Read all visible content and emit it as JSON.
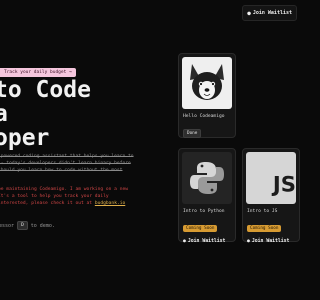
{
  "header": {
    "waitlist_label": "Join Waitlist",
    "waitlist_icon": "bell-icon"
  },
  "banner": {
    "text": "Track your daily budget →"
  },
  "hero": {
    "line1": "to Code",
    "line2": "a",
    "line3": "oper"
  },
  "description": {
    "text": "-powered coding assistant that helps you learn to -- today's developers didn't learn binary before should you learn how to code without the most"
  },
  "notice": {
    "text_before": "be maintaining Codeamigo. I am working on a new It's a tool to help you track your daily interested, please check it out at",
    "link_text": "budgbank.io"
  },
  "hint": {
    "prefix": "ressor",
    "key": "D",
    "suffix": "to demo."
  },
  "cards": {
    "codeamigo": {
      "title": "Hello Codeamigo",
      "badge": "Done",
      "thumb_icon": "corgi-icon"
    },
    "python": {
      "title": "Intro to Python",
      "badge": "Coming Soon",
      "join_label": "Join Waitlist",
      "thumb_icon": "python-logo-icon"
    },
    "js": {
      "title": "Intro to JS",
      "badge": "Coming Soon",
      "join_label": "Join Waitlist",
      "thumb_icon": "js-logo-icon",
      "thumb_text": "JS"
    }
  },
  "colors": {
    "background": "#0a0a0a",
    "banner": "#f5c6dd",
    "notice": "#d14646",
    "coming_soon": "#d79b32"
  }
}
